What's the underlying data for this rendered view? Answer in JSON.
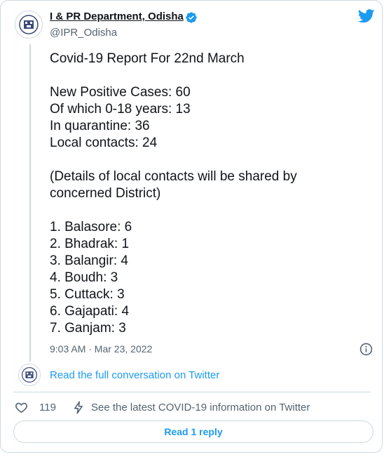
{
  "tweet": {
    "author_name": "I & PR Department, Odisha",
    "author_handle": "@IPR_Odisha",
    "lines": [
      "Covid-19 Report For 22nd March",
      "",
      "New Positive Cases: 60",
      "Of which 0-18 years: 13",
      "In quarantine: 36",
      "Local contacts: 24",
      "",
      "(Details of local contacts will be shared by",
      "concerned District)",
      "",
      "1. Balasore: 6",
      "2. Bhadrak: 1",
      "3. Balangir: 4",
      "4. Boudh: 3",
      "5. Cuttack: 3",
      "6. Gajapati: 4",
      "7. Ganjam: 3"
    ],
    "timestamp": "9:03 AM · Mar 23, 2022"
  },
  "conversation_link": "Read the full conversation on Twitter",
  "actions": {
    "like_count": "119",
    "covid_info": "See the latest COVID-19 information on Twitter"
  },
  "reply_button": "Read 1 reply",
  "colors": {
    "accent": "#1d9bf0",
    "secondary_text": "#536471",
    "border": "#cfd9de"
  },
  "icons": [
    "verified-badge-icon",
    "twitter-bird-icon",
    "info-icon",
    "heart-icon",
    "lightning-icon"
  ]
}
